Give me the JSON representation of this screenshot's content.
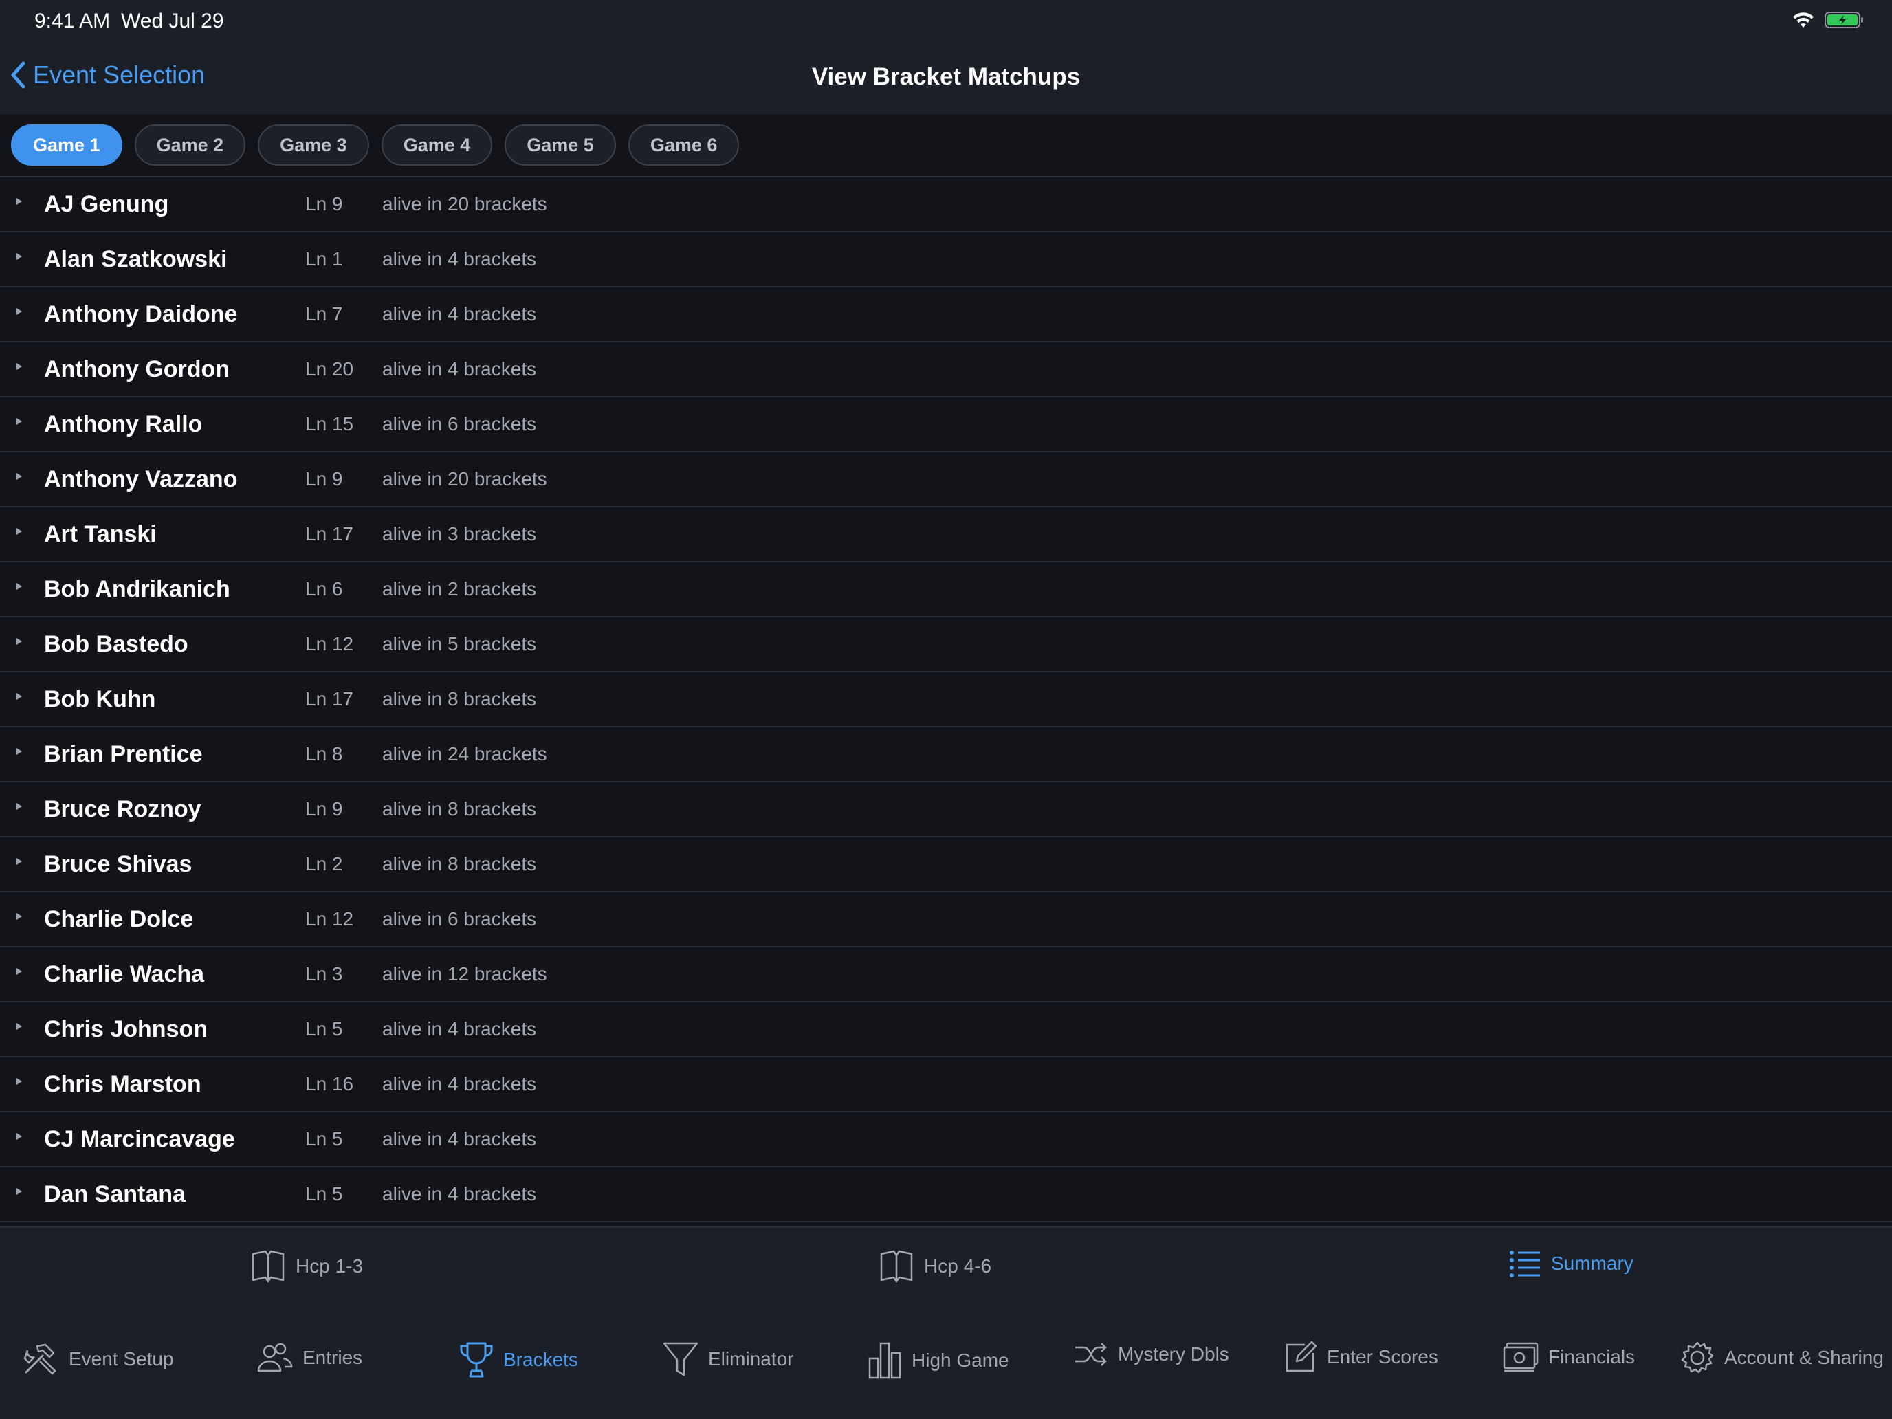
{
  "status": {
    "time": "9:41 AM",
    "date": "Wed Jul 29"
  },
  "nav": {
    "back_label": "Event Selection",
    "title": "View Bracket Matchups"
  },
  "games": [
    {
      "label": "Game 1",
      "active": true
    },
    {
      "label": "Game 2",
      "active": false
    },
    {
      "label": "Game 3",
      "active": false
    },
    {
      "label": "Game 4",
      "active": false
    },
    {
      "label": "Game 5",
      "active": false
    },
    {
      "label": "Game 6",
      "active": false
    }
  ],
  "bowlers": [
    {
      "name": "AJ Genung",
      "lane": "Ln 9",
      "alive": "alive in 20 brackets"
    },
    {
      "name": "Alan Szatkowski",
      "lane": "Ln 1",
      "alive": "alive in 4 brackets"
    },
    {
      "name": "Anthony Daidone",
      "lane": "Ln 7",
      "alive": "alive in 4 brackets"
    },
    {
      "name": "Anthony Gordon",
      "lane": "Ln 20",
      "alive": "alive in 4 brackets"
    },
    {
      "name": "Anthony Rallo",
      "lane": "Ln 15",
      "alive": "alive in 6 brackets"
    },
    {
      "name": "Anthony Vazzano",
      "lane": "Ln 9",
      "alive": "alive in 20 brackets"
    },
    {
      "name": "Art Tanski",
      "lane": "Ln 17",
      "alive": "alive in 3 brackets"
    },
    {
      "name": "Bob Andrikanich",
      "lane": "Ln 6",
      "alive": "alive in 2 brackets"
    },
    {
      "name": "Bob Bastedo",
      "lane": "Ln 12",
      "alive": "alive in 5 brackets"
    },
    {
      "name": "Bob Kuhn",
      "lane": "Ln 17",
      "alive": "alive in 8 brackets"
    },
    {
      "name": "Brian Prentice",
      "lane": "Ln 8",
      "alive": "alive in 24 brackets"
    },
    {
      "name": "Bruce Roznoy",
      "lane": "Ln 9",
      "alive": "alive in 8 brackets"
    },
    {
      "name": "Bruce Shivas",
      "lane": "Ln 2",
      "alive": "alive in 8 brackets"
    },
    {
      "name": "Charlie Dolce",
      "lane": "Ln 12",
      "alive": "alive in 6 brackets"
    },
    {
      "name": "Charlie Wacha",
      "lane": "Ln 3",
      "alive": "alive in 12 brackets"
    },
    {
      "name": "Chris Johnson",
      "lane": "Ln 5",
      "alive": "alive in 4 brackets"
    },
    {
      "name": "Chris Marston",
      "lane": "Ln 16",
      "alive": "alive in 4 brackets"
    },
    {
      "name": "CJ Marcincavage",
      "lane": "Ln 5",
      "alive": "alive in 4 brackets"
    },
    {
      "name": "Dan Santana",
      "lane": "Ln 5",
      "alive": "alive in 4 brackets"
    }
  ],
  "sub_toolbar": {
    "hcp13": "Hcp 1-3",
    "hcp46": "Hcp 4-6",
    "summary": "Summary"
  },
  "tabbar": {
    "event_setup": "Event Setup",
    "entries": "Entries",
    "brackets": "Brackets",
    "eliminator": "Eliminator",
    "high_game": "High Game",
    "mystery_dbls": "Mystery Dbls",
    "enter_scores": "Enter Scores",
    "financials": "Financials",
    "account_sharing": "Account & Sharing"
  },
  "colors": {
    "accent": "#4a9cf0",
    "background": "#121419",
    "bar": "#1b1f27",
    "battery": "#34c759"
  },
  "icons": [
    "wifi-icon",
    "battery-icon",
    "chevron-left-icon",
    "book-icon",
    "list-icon",
    "tools-icon",
    "people-icon",
    "trophy-icon",
    "funnel-icon",
    "bar-chart-icon",
    "shuffle-icon",
    "edit-icon",
    "money-icon",
    "gear-icon"
  ]
}
